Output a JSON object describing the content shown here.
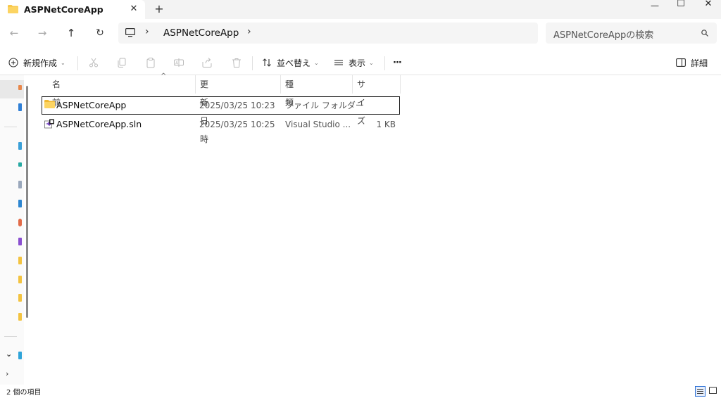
{
  "window": {
    "tab_title": "ASPNetCoreApp",
    "tab_close": "✕",
    "new_tab": "+",
    "minimize": "—",
    "maximize": "☐",
    "close": "✕"
  },
  "nav": {
    "back": "←",
    "forward": "→",
    "up": "↑",
    "refresh": "↻",
    "breadcrumb_sep": "›",
    "path": "ASPNetCoreApp",
    "search_placeholder": "ASPNetCoreAppの検索"
  },
  "toolbar": {
    "new_label": "新規作成",
    "sort_label": "並べ替え",
    "view_label": "表示",
    "more": "···",
    "details_label": "詳細"
  },
  "columns": {
    "name": "名前",
    "date": "更新日時",
    "type": "種類",
    "size": "サイズ"
  },
  "files": [
    {
      "name": "ASPNetCoreApp",
      "date": "2025/03/25 10:23",
      "type": "ファイル フォルダー",
      "size": "",
      "icon": "folder-icon"
    },
    {
      "name": "ASPNetCoreApp.sln",
      "date": "2025/03/25 10:25",
      "type": "Visual Studio ...",
      "size": "1 KB",
      "icon": "visual-studio-solution-icon"
    }
  ],
  "status": {
    "item_count": "2 個の項目"
  },
  "colors": {
    "folder": "#f8c84a",
    "titlebar": "#f3f3f3",
    "selection": "#e8e8e8"
  }
}
